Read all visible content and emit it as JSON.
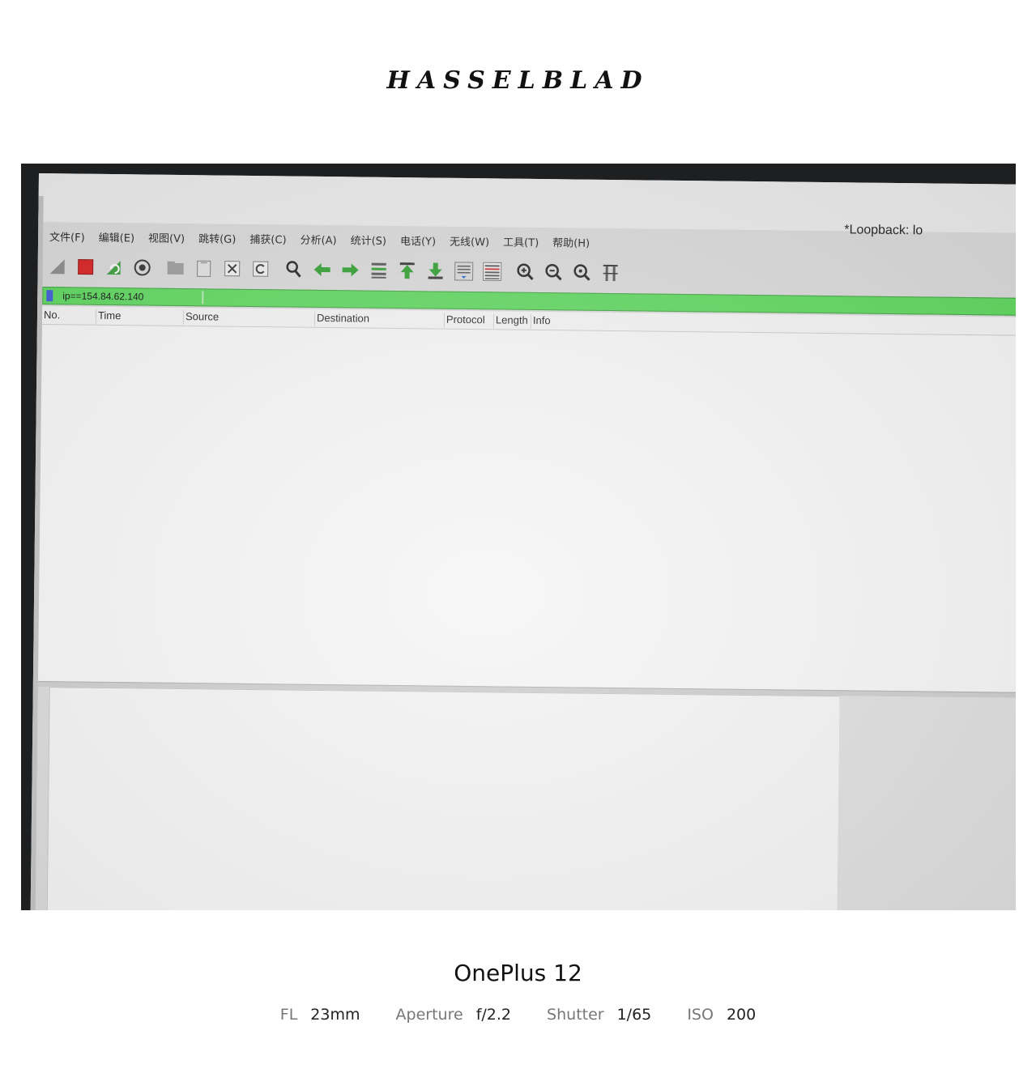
{
  "frame": {
    "brand": "HASSELBLAD",
    "camera_model": "OnePlus 12",
    "specs": [
      {
        "label": "FL",
        "value": "23mm"
      },
      {
        "label": "Aperture",
        "value": "f/2.2"
      },
      {
        "label": "Shutter",
        "value": "1/65"
      },
      {
        "label": "ISO",
        "value": "200"
      }
    ]
  },
  "window": {
    "title": "*Loopback: lo"
  },
  "menu": {
    "items": [
      "文件(F)",
      "编辑(E)",
      "视图(V)",
      "跳转(G)",
      "捕获(C)",
      "分析(A)",
      "统计(S)",
      "电话(Y)",
      "无线(W)",
      "工具(T)",
      "帮助(H)"
    ]
  },
  "toolbar": {
    "icons": [
      "shark-fin-icon",
      "stop-capture-icon",
      "restart-capture-icon",
      "capture-options-icon",
      "open-file-icon",
      "save-file-icon",
      "close-file-icon",
      "reload-file-icon",
      "find-packet-icon",
      "go-back-icon",
      "go-forward-icon",
      "go-to-packet-icon",
      "first-packet-icon",
      "last-packet-icon",
      "auto-scroll-icon",
      "colorize-icon",
      "zoom-in-icon",
      "zoom-out-icon",
      "normal-size-icon",
      "resize-columns-icon"
    ]
  },
  "filter": {
    "value": "ip==154.84.62.140",
    "color": "#5cd65c"
  },
  "packet_list": {
    "columns": [
      "No.",
      "Time",
      "Source",
      "Destination",
      "Protocol",
      "Length",
      "Info"
    ]
  }
}
